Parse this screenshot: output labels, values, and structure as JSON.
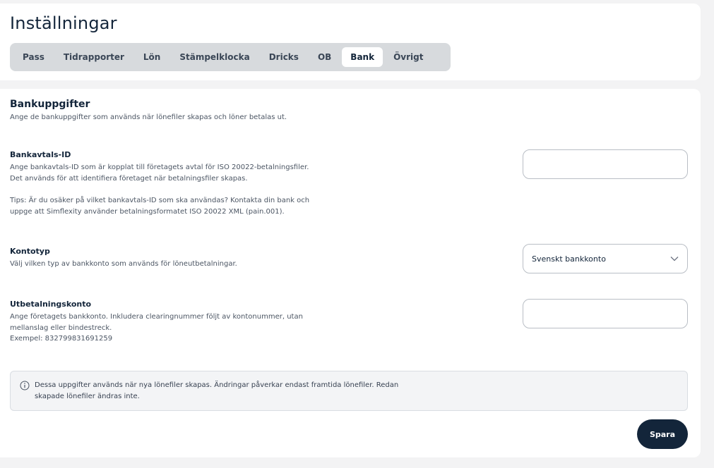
{
  "header": {
    "title": "Inställningar",
    "tabs": [
      {
        "label": "Pass"
      },
      {
        "label": "Tidrapporter"
      },
      {
        "label": "Lön"
      },
      {
        "label": "Stämpelklocka"
      },
      {
        "label": "Dricks"
      },
      {
        "label": "OB"
      },
      {
        "label": "Bank"
      },
      {
        "label": "Övrigt"
      }
    ],
    "active_tab": "Bank"
  },
  "bank": {
    "title": "Bankuppgifter",
    "subtitle": "Ange de bankuppgifter som används när lönefiler skapas och löner betalas ut.",
    "agreement": {
      "label": "Bankavtals-ID",
      "description_1": "Ange bankavtals-ID som är kopplat till företagets avtal för ISO 20022-betalningsfiler. Det används för att identifiera företaget när betalningsfiler skapas.",
      "description_2": "Tips: Är du osäker på vilket bankavtals-ID som ska användas? Kontakta din bank och uppge att Simflexity använder betalningsformatet ISO 20022 XML (pain.001).",
      "value": ""
    },
    "account_type": {
      "label": "Kontotyp",
      "description": "Välj vilken typ av bankkonto som används för löneutbetalningar.",
      "selected": "Svenskt bankkonto"
    },
    "payout_account": {
      "label": "Utbetalningskonto",
      "description": "Ange företagets bankkonto. Inkludera clearingnummer följt av kontonummer, utan mellanslag eller bindestreck.",
      "example": "Exempel: 832799831691259",
      "value": ""
    },
    "notice": "Dessa uppgifter används när nya lönefiler skapas. Ändringar påverkar endast framtida lönefiler. Redan skapade lönefiler ändras inte.",
    "save_label": "Spara"
  },
  "icons": {
    "info": "info-circle-icon",
    "chevron": "chevron-down-icon"
  },
  "colors": {
    "primary": "#13253a",
    "tab_bar": "#d7dadd",
    "background": "#f3f3f4"
  }
}
